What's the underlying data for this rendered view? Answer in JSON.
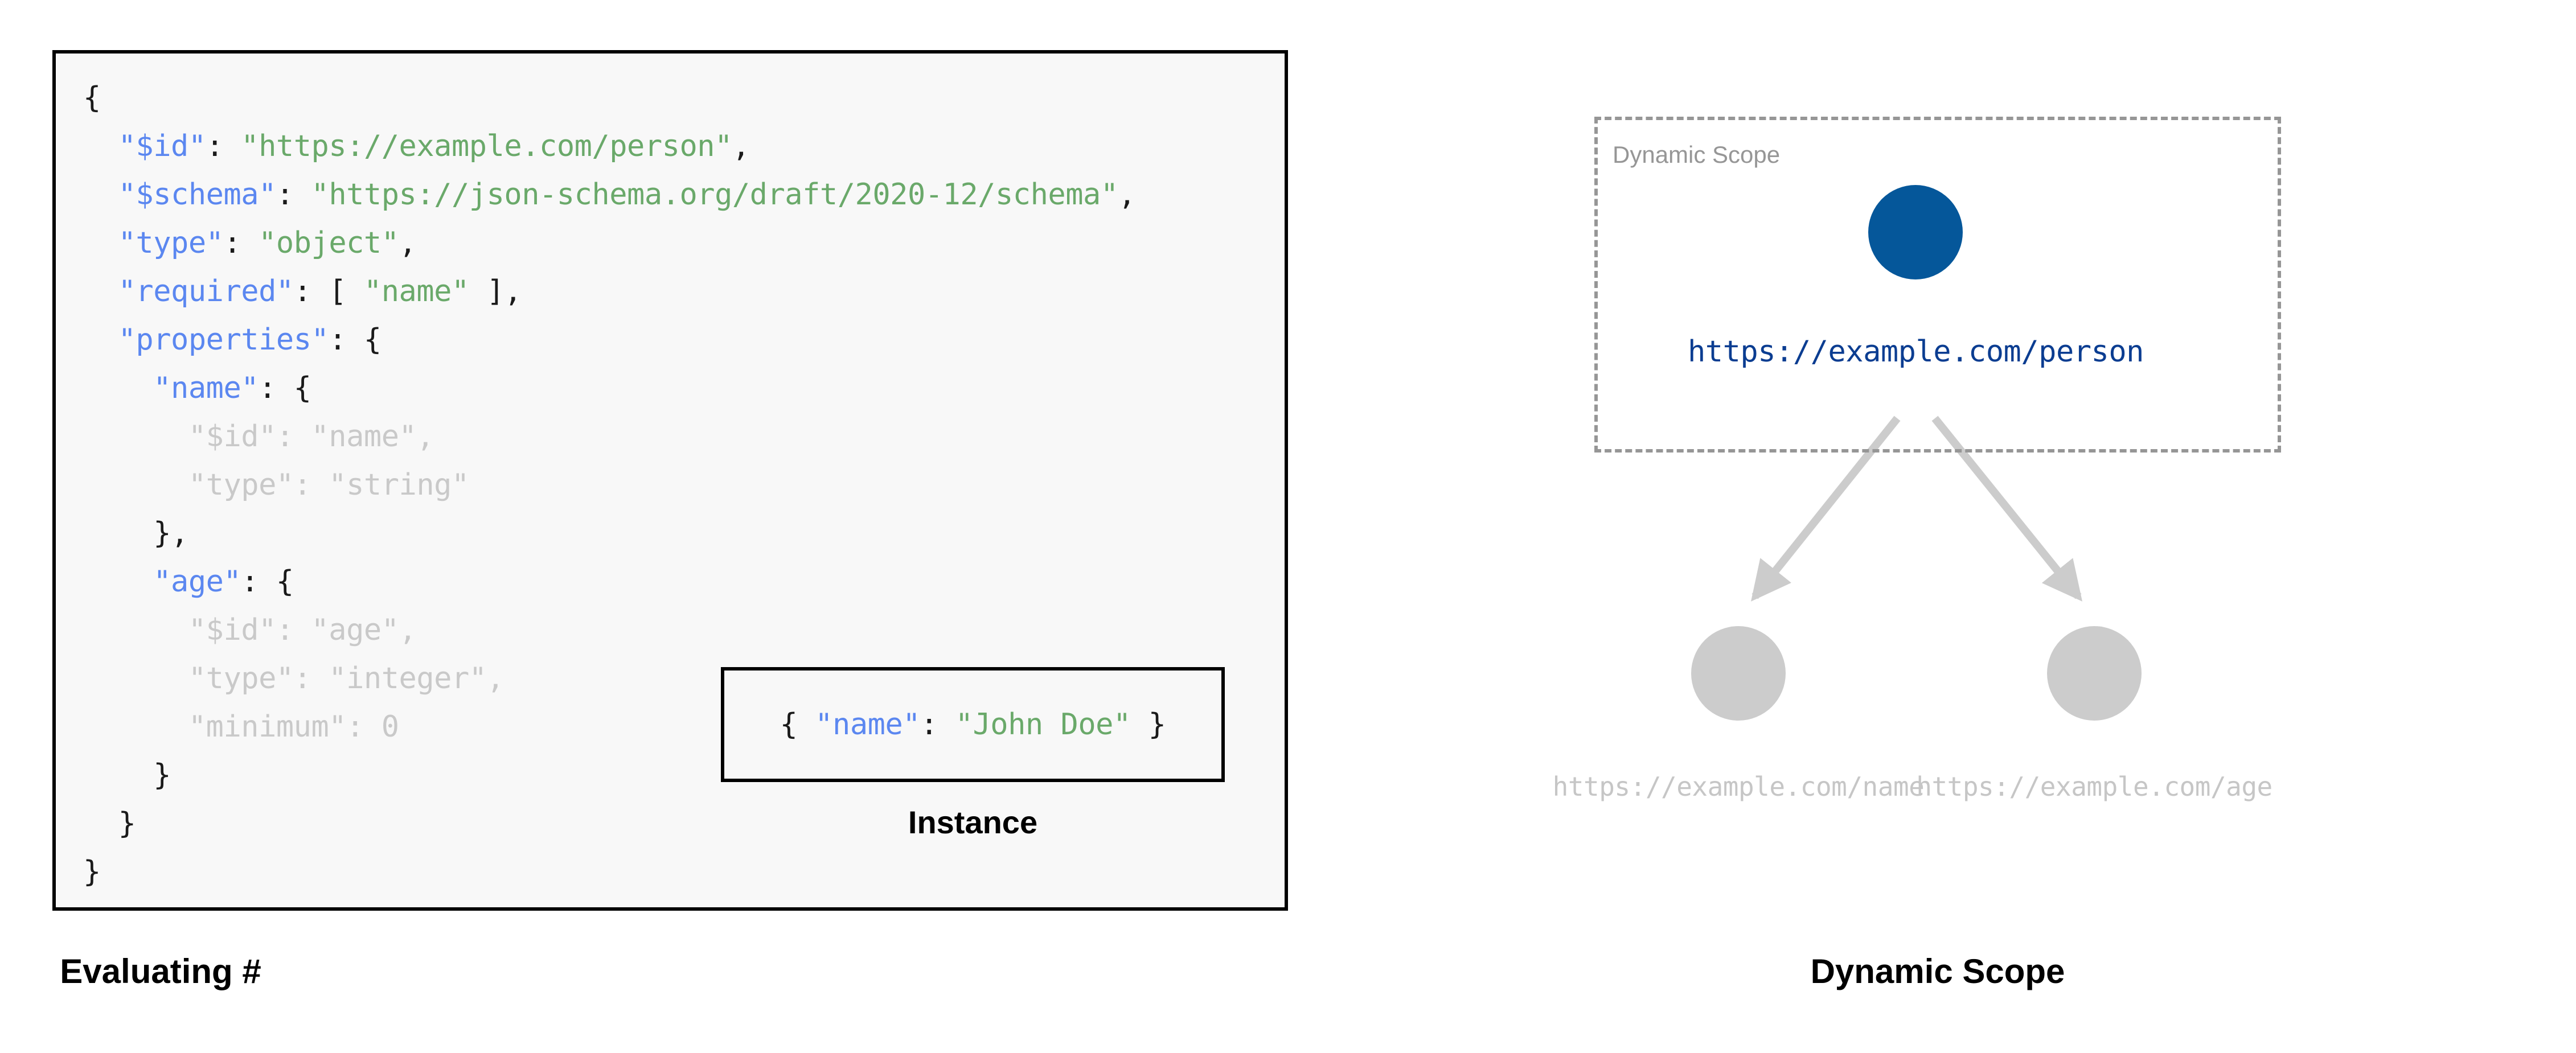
{
  "left": {
    "caption": "Evaluating #",
    "code_lines": [
      [
        {
          "t": "{",
          "c": "p"
        }
      ],
      [
        {
          "t": "  ",
          "c": "p"
        },
        {
          "t": "\"$id\"",
          "c": "k"
        },
        {
          "t": ": ",
          "c": "p"
        },
        {
          "t": "\"https://example.com/person\"",
          "c": "s"
        },
        {
          "t": ",",
          "c": "p"
        }
      ],
      [
        {
          "t": "  ",
          "c": "p"
        },
        {
          "t": "\"$schema\"",
          "c": "k"
        },
        {
          "t": ": ",
          "c": "p"
        },
        {
          "t": "\"https://json-schema.org/draft/2020-12/schema\"",
          "c": "s"
        },
        {
          "t": ",",
          "c": "p"
        }
      ],
      [
        {
          "t": "  ",
          "c": "p"
        },
        {
          "t": "\"type\"",
          "c": "k"
        },
        {
          "t": ": ",
          "c": "p"
        },
        {
          "t": "\"object\"",
          "c": "s"
        },
        {
          "t": ",",
          "c": "p"
        }
      ],
      [
        {
          "t": "  ",
          "c": "p"
        },
        {
          "t": "\"required\"",
          "c": "k"
        },
        {
          "t": ": [ ",
          "c": "p"
        },
        {
          "t": "\"name\"",
          "c": "s"
        },
        {
          "t": " ],",
          "c": "p"
        }
      ],
      [
        {
          "t": "  ",
          "c": "p"
        },
        {
          "t": "\"properties\"",
          "c": "k"
        },
        {
          "t": ": {",
          "c": "p"
        }
      ],
      [
        {
          "t": "    ",
          "c": "p"
        },
        {
          "t": "\"name\"",
          "c": "k"
        },
        {
          "t": ": {",
          "c": "p"
        }
      ],
      [
        {
          "t": "      \"$id\": \"name\",",
          "c": "d"
        }
      ],
      [
        {
          "t": "      \"type\": \"string\"",
          "c": "d"
        }
      ],
      [
        {
          "t": "    },",
          "c": "p"
        }
      ],
      [
        {
          "t": "    ",
          "c": "p"
        },
        {
          "t": "\"age\"",
          "c": "k"
        },
        {
          "t": ": {",
          "c": "p"
        }
      ],
      [
        {
          "t": "      \"$id\": \"age\",",
          "c": "d"
        }
      ],
      [
        {
          "t": "      \"type\": \"integer\",",
          "c": "d"
        }
      ],
      [
        {
          "t": "      \"minimum\": 0",
          "c": "d"
        }
      ],
      [
        {
          "t": "    }",
          "c": "p"
        }
      ],
      [
        {
          "t": "  }",
          "c": "p"
        }
      ],
      [
        {
          "t": "}",
          "c": "p"
        }
      ]
    ],
    "instance": {
      "caption": "Instance",
      "parts": [
        {
          "t": "{ ",
          "c": "p"
        },
        {
          "t": "\"name\"",
          "c": "k"
        },
        {
          "t": ": ",
          "c": "p"
        },
        {
          "t": "\"John Doe\"",
          "c": "s"
        },
        {
          "t": " }",
          "c": "p"
        }
      ]
    }
  },
  "right": {
    "caption": "Dynamic Scope",
    "scope_label": "Dynamic Scope",
    "root_node_label": "https://example.com/person",
    "child_nodes": [
      {
        "label": "https://example.com/name"
      },
      {
        "label": "https://example.com/age"
      }
    ]
  },
  "colors": {
    "root_node_fill": "#05579a",
    "child_node_fill": "#cccccc",
    "edge": "#cccccc",
    "scope_border": "#969696",
    "key_blue": "#5b87f0",
    "string_green": "#6aa96a",
    "dimmed_gray": "#c9c9c9",
    "root_label_blue": "#0b3d91",
    "panel_bg": "#f8f8f8",
    "panel_border": "#000000"
  }
}
